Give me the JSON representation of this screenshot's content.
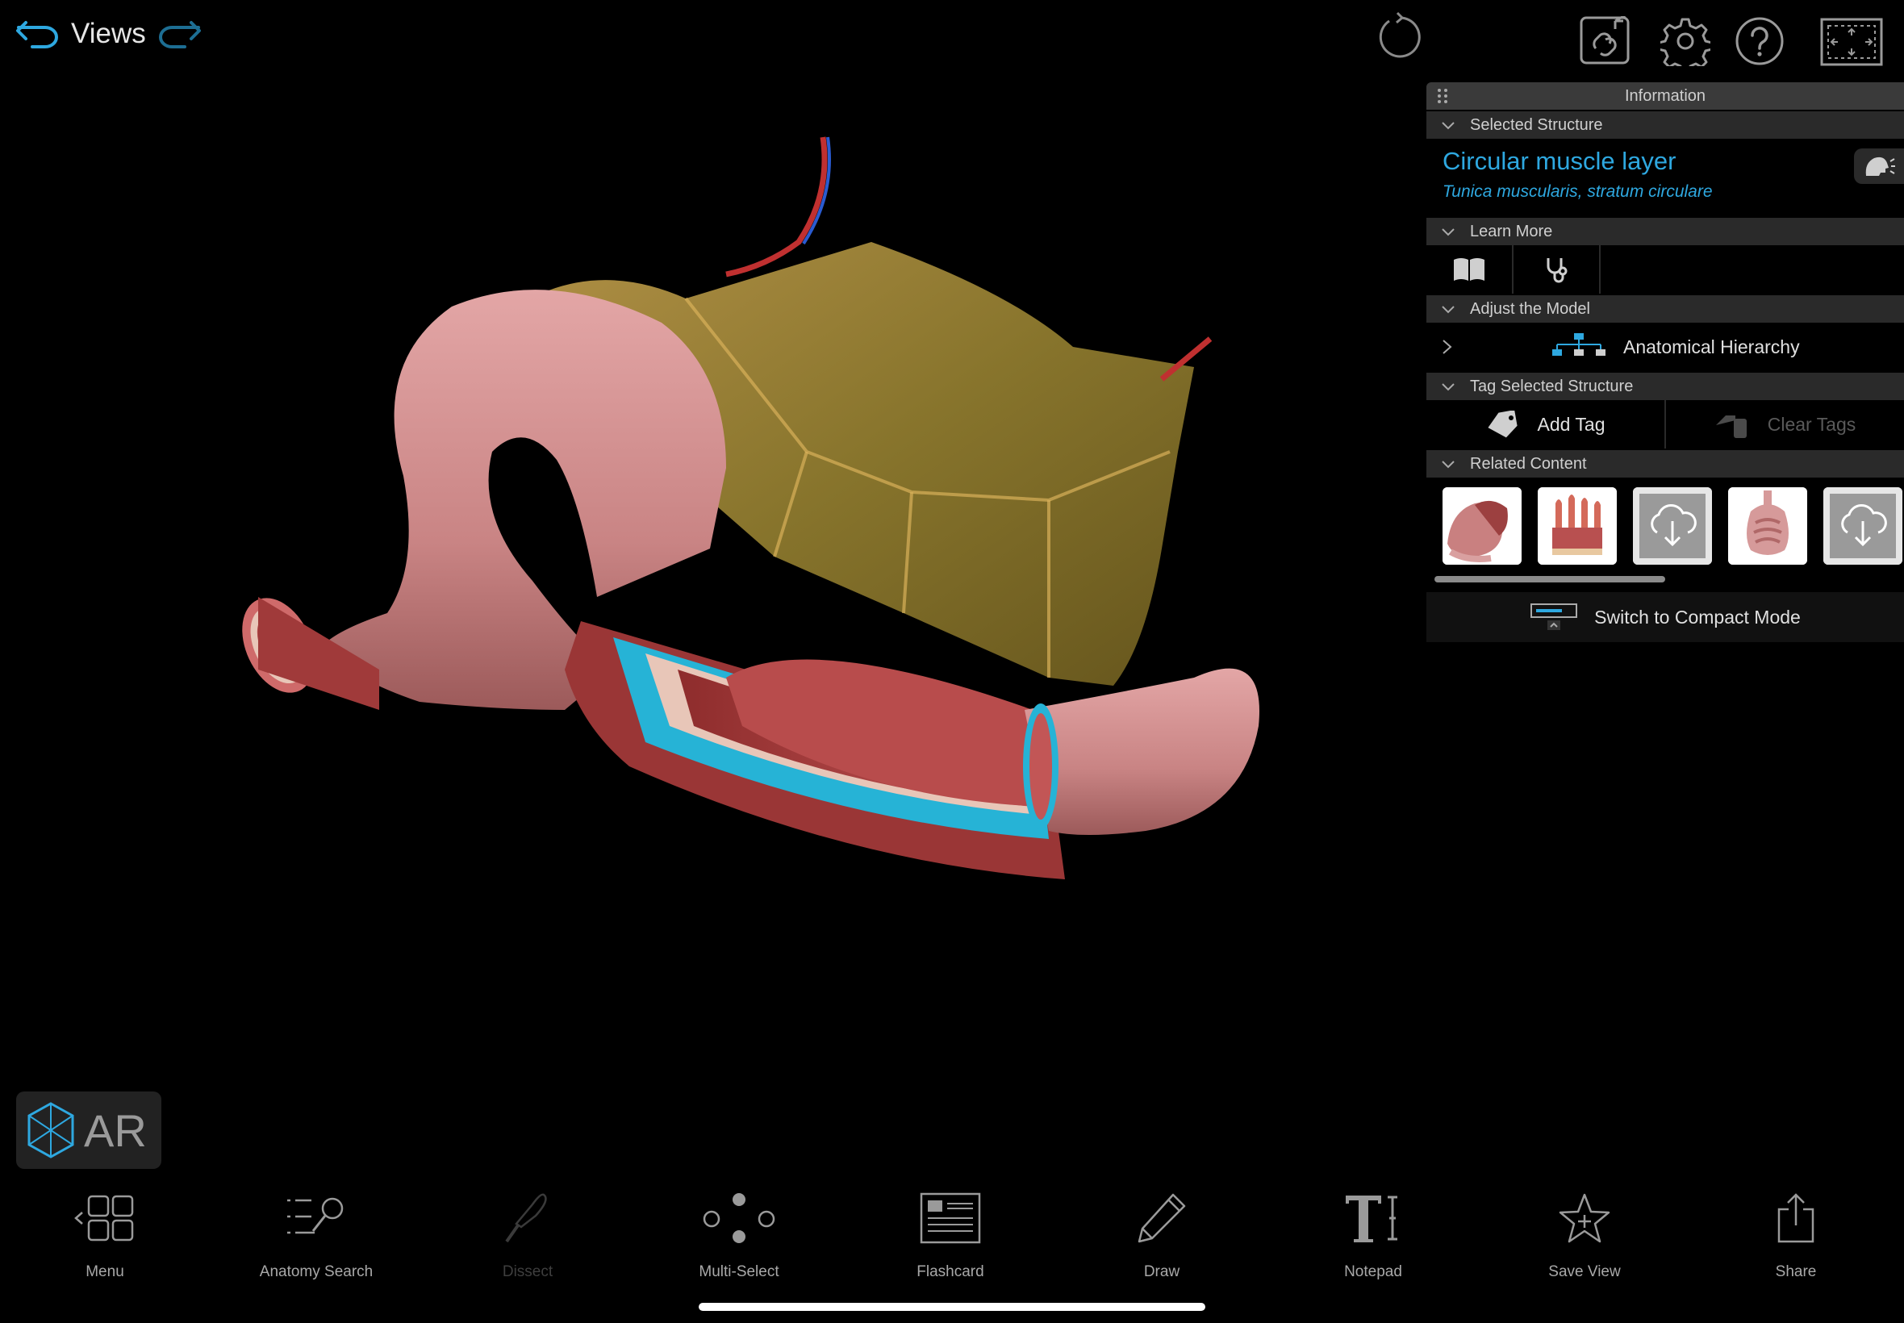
{
  "topbar": {
    "views_label": "Views",
    "back_icon": "undo-arrow-icon",
    "forward_icon": "redo-arrow-icon",
    "reset_icon": "reset-rotate-icon",
    "right_icons": [
      "link-icon",
      "settings-gear-icon",
      "help-icon",
      "fullscreen-icon"
    ]
  },
  "info_panel": {
    "title": "Information",
    "sections": {
      "selected_structure": "Selected Structure",
      "learn_more": "Learn More",
      "adjust_model": "Adjust the Model",
      "tag_structure": "Tag Selected Structure",
      "related_content": "Related Content"
    },
    "structure": {
      "name": "Circular muscle layer",
      "latin": "Tunica muscularis, stratum circulare"
    },
    "learn_more_icons": [
      "book-icon",
      "stethoscope-icon"
    ],
    "hierarchy_label": "Anatomical Hierarchy",
    "add_tag_label": "Add Tag",
    "clear_tags_label": "Clear Tags",
    "related_thumbs": [
      "stomach-thumbnail",
      "intestinal-wall-thumbnail",
      "download-thumbnail",
      "digestive-system-thumbnail",
      "download-thumbnail"
    ],
    "compact_mode_label": "Switch to Compact Mode"
  },
  "ar": {
    "label": "AR"
  },
  "toolbar": {
    "items": [
      {
        "label": "Menu",
        "icon": "menu-grid-icon",
        "enabled": true
      },
      {
        "label": "Anatomy Search",
        "icon": "anatomy-search-icon",
        "enabled": true
      },
      {
        "label": "Dissect",
        "icon": "scalpel-icon",
        "enabled": false
      },
      {
        "label": "Multi-Select",
        "icon": "multi-select-icon",
        "enabled": true
      },
      {
        "label": "Flashcard",
        "icon": "flashcard-icon",
        "enabled": true
      },
      {
        "label": "Draw",
        "icon": "pencil-icon",
        "enabled": true
      },
      {
        "label": "Notepad",
        "icon": "notepad-text-icon",
        "enabled": true
      },
      {
        "label": "Save View",
        "icon": "save-view-star-icon",
        "enabled": true
      },
      {
        "label": "Share",
        "icon": "share-icon",
        "enabled": true
      }
    ]
  },
  "colors": {
    "accent": "#2ea8e0",
    "panel_header": "#2a2a2a",
    "background": "#000000"
  }
}
